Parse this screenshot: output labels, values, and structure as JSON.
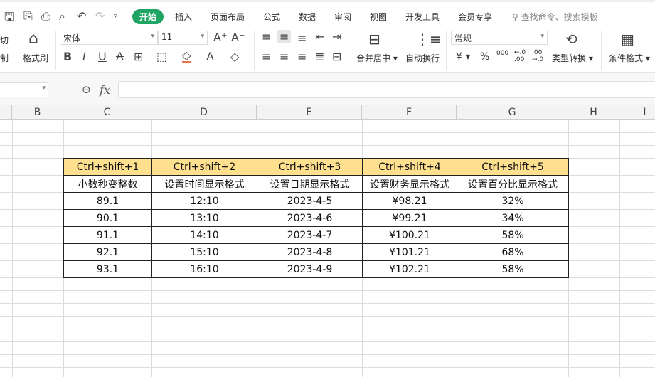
{
  "toolbar": {
    "tabs": [
      "开始",
      "插入",
      "页面布局",
      "公式",
      "数据",
      "审阅",
      "视图",
      "开发工具",
      "会员专享"
    ],
    "search_placeholder": "查找命令、搜索模板"
  },
  "ribbon": {
    "cut": "切",
    "copy": "制",
    "format_painter": "格式刷",
    "font_name": "宋体",
    "font_size": "11",
    "merge": "合并居中",
    "wrap": "自动换行",
    "number_format": "常规",
    "type_convert": "类型转换",
    "conditional_format": "条件格式",
    "currency": "¥",
    "percent": "%",
    "thousands": "000",
    "inc_dec": "←.0 .00",
    "dec_dec": ".00 →.0"
  },
  "formula_bar": {
    "fx": "fx",
    "value": ""
  },
  "columns": [
    "B",
    "C",
    "D",
    "E",
    "F",
    "G",
    "H",
    "I"
  ],
  "table": {
    "headers": [
      "Ctrl+shift+1",
      "Ctrl+shift+2",
      "Ctrl+shift+3",
      "Ctrl+shift+4",
      "Ctrl+shift+5"
    ],
    "subheaders": [
      "小数秒变整数",
      "设置时间显示格式",
      "设置日期显示格式",
      "设置财务显示格式",
      "设置百分比显示格式"
    ],
    "rows": [
      [
        "89.1",
        "12:10",
        "2023-4-5",
        "¥98.21",
        "32%"
      ],
      [
        "90.1",
        "13:10",
        "2023-4-6",
        "¥99.21",
        "34%"
      ],
      [
        "91.1",
        "14:10",
        "2023-4-7",
        "¥100.21",
        "58%"
      ],
      [
        "92.1",
        "15:10",
        "2023-4-8",
        "¥101.21",
        "68%"
      ],
      [
        "93.1",
        "16:10",
        "2023-4-9",
        "¥102.21",
        "58%"
      ]
    ]
  }
}
